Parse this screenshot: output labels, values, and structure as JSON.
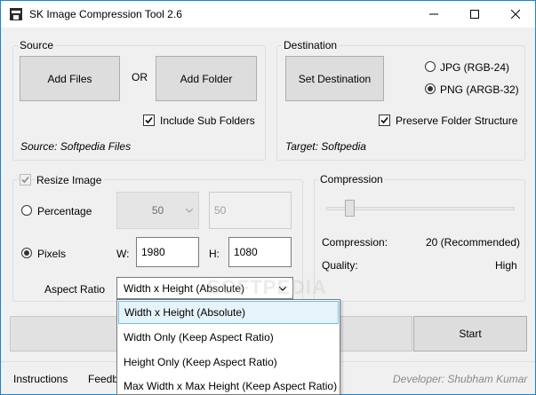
{
  "window": {
    "title": "SK Image Compression Tool 2.6",
    "accent_color": "#1883d7"
  },
  "source": {
    "legend": "Source",
    "add_files": "Add Files",
    "or_label": "OR",
    "add_folder": "Add Folder",
    "include_subfolders_label": "Include Sub Folders",
    "include_subfolders_checked": true,
    "status": "Source: Softpedia Files"
  },
  "destination": {
    "legend": "Destination",
    "set_destination": "Set Destination",
    "jpg_label": "JPG (RGB-24)",
    "png_label": "PNG (ARGB-32)",
    "selected_format": "PNG (ARGB-32)",
    "preserve_label": "Preserve Folder Structure",
    "preserve_checked": true,
    "status": "Target: Softpedia"
  },
  "resize": {
    "legend": "Resize Image",
    "enabled": true,
    "percentage_label": "Percentage",
    "percentage_combo_value": "50",
    "percentage_field_value": "50",
    "pixels_label": "Pixels",
    "mode": "Pixels",
    "width_label": "W:",
    "width_value": "1980",
    "height_label": "H:",
    "height_value": "1080",
    "aspect_label": "Aspect Ratio",
    "aspect_selected": "Width x Height (Absolute)",
    "aspect_options": [
      "Width x Height (Absolute)",
      "Width Only (Keep Aspect Ratio)",
      "Height Only (Keep Aspect Ratio)",
      "Max Width x Max Height (Keep Aspect Ratio)"
    ]
  },
  "compression": {
    "legend": "Compression",
    "slider_value": 20,
    "compression_label": "Compression:",
    "compression_value": "20 (Recommended)",
    "quality_label": "Quality:",
    "quality_value": "High"
  },
  "actions": {
    "start": "Start"
  },
  "footer": {
    "instructions": "Instructions",
    "feedback_partial": "Feedb",
    "developer": "Developer: Shubham Kumar"
  },
  "watermark": "SOFTPEDIA"
}
